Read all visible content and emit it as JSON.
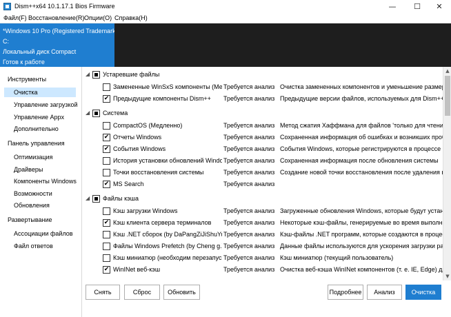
{
  "window": {
    "title": "Dism++x64 10.1.17.1 Bios Firmware",
    "minimize_glyph": "—",
    "maximize_glyph": "☐",
    "close_glyph": "✕"
  },
  "menu": [
    "Файл(F)",
    "Восстановление(R)",
    "Опции(O)",
    "Справка(H)"
  ],
  "session": {
    "os": "*Windows 10 Pro (Registered Trademark)",
    "drive": "C:",
    "disk": "Локальный диск Compact",
    "state": "Готов к работе"
  },
  "sidebar": {
    "tools_header": "Инструменты",
    "tools": [
      "Очистка",
      "Управление загрузкой",
      "Управление Appx",
      "Дополнительно"
    ],
    "panel_header": "Панель управления",
    "panel": [
      "Оптимизация",
      "Драйверы",
      "Компоненты Windows",
      "Возможности",
      "Обновления"
    ],
    "deploy_header": "Развертывание",
    "deploy": [
      "Ассоциации файлов",
      "Файл ответов"
    ],
    "selected": "Очистка"
  },
  "cleanup": {
    "groups": [
      {
        "name": "Устаревшие файлы",
        "items": [
          {
            "name": "Замененные WinSxS компоненты (Медленно)",
            "status": "Требуется анализ",
            "description": "Очистка замененных компонентов и уменьшение размера",
            "checked": false
          },
          {
            "name": "Предыдущие компоненты Dism++",
            "status": "Требуется анализ",
            "description": "Предыдущие версии файлов, используемых для Dism++.",
            "checked": true
          }
        ]
      },
      {
        "name": "Система",
        "items": [
          {
            "name": "CompactOS (Медленно)",
            "status": "Требуется анализ",
            "description": "Метод сжатия Хаффмана для файлов 'только для чтения'.",
            "checked": false
          },
          {
            "name": "Отчеты Windows",
            "status": "Требуется анализ",
            "description": "Сохраненная информация об ошибках и возникших проблемах",
            "checked": true
          },
          {
            "name": "События Windows",
            "status": "Требуется анализ",
            "description": "События Windows, которые регистрируются в процессе работы",
            "checked": true
          },
          {
            "name": "История установки обновлений Windows",
            "status": "Требуется анализ",
            "description": "Сохраненная информация после обновления системы",
            "checked": false
          },
          {
            "name": "Точки восстановления системы",
            "status": "Требуется анализ",
            "description": "Создание новой точки восстановления после удаления всех",
            "checked": false
          },
          {
            "name": "MS Search",
            "status": "Требуется анализ",
            "description": "",
            "checked": true
          }
        ]
      },
      {
        "name": "Файлы кэша",
        "items": [
          {
            "name": "Кэш загрузки Windows",
            "status": "Требуется анализ",
            "description": "Загруженные обновления Windows, которые будут установлены",
            "checked": false
          },
          {
            "name": "Кэш клиента сервера терминалов",
            "status": "Требуется анализ",
            "description": "Некоторые кэш-файлы, генерируемые во время выполнения",
            "checked": true
          },
          {
            "name": "Кэш .NET сборок (by DaPangZiJiShuYuan)",
            "status": "Требуется анализ",
            "description": "Кэш-файлы .NET программ, которые создаются в процессе",
            "checked": false
          },
          {
            "name": "Файлы Windows Prefetch (by Cheng g.)",
            "status": "Требуется анализ",
            "description": "Данные файлы используются для ускорения загрузки ранее",
            "checked": false
          },
          {
            "name": "Кэш миниатюр (необходим перезапуск ПК)",
            "status": "Требуется анализ",
            "description": "Кэш миниатюр (текущий пользователь)",
            "checked": false
          },
          {
            "name": "WinINet веб-кэш",
            "status": "Требуется анализ",
            "description": "Очистка веб-кэша WinINet компонентов (т. е. IE, Edge) для",
            "checked": true
          }
        ]
      }
    ]
  },
  "buttons": {
    "uncheck": "Снять",
    "reset": "Сброс",
    "refresh": "Обновить",
    "details": "Подробнее",
    "analyze": "Анализ",
    "clean": "Очистка"
  },
  "colors": {
    "accent": "#1f7ed0",
    "selection": "#cde8ff",
    "session_dark": "#1e1e1e"
  }
}
